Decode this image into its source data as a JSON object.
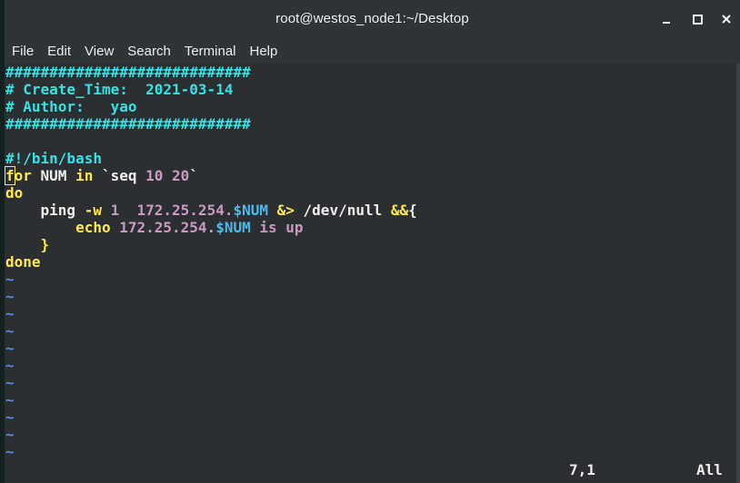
{
  "window": {
    "title": "root@westos_node1:~/Desktop"
  },
  "menubar": {
    "items": [
      "File",
      "Edit",
      "View",
      "Search",
      "Terminal",
      "Help"
    ]
  },
  "editor": {
    "lines": {
      "hashes1": "############################",
      "create_time": "# Create_Time:  2021-03-14",
      "author": "# Author:   yao",
      "hashes2": "############################",
      "shebang": "#!/bin/bash",
      "for_kw_f": "f",
      "for_kw_rest": "or",
      "for_var": " NUM ",
      "for_in": "in",
      "for_tick": " `",
      "for_seq": "seq",
      "for_nums": " 10 20",
      "for_tick2": "`",
      "do": "do",
      "ping_indent": "    ",
      "ping_cmd": "ping ",
      "ping_flag": "-w",
      "ping_1": " 1  ",
      "ping_ip": "172.25.254.",
      "ping_var": "$NUM",
      "ping_redir": " &>",
      "ping_null": " /dev/null ",
      "ping_and": "&&",
      "ping_brace": "{",
      "echo_indent": "        ",
      "echo_cmd": "echo",
      "echo_text": " 172.25.254.",
      "echo_var": "$NUM",
      "echo_tail": " is up",
      "close_indent": "    ",
      "close_brace": "}",
      "done": "done",
      "tilde": "~"
    },
    "status": {
      "position": "7,1",
      "scroll": "All"
    }
  },
  "colors": {
    "comment": "#34e2e2",
    "keyword": "#fce94f",
    "string": "#c99ac0",
    "variable": "#4fb7e8",
    "tilde": "#5c8ad8",
    "background": "#2b2f31"
  }
}
